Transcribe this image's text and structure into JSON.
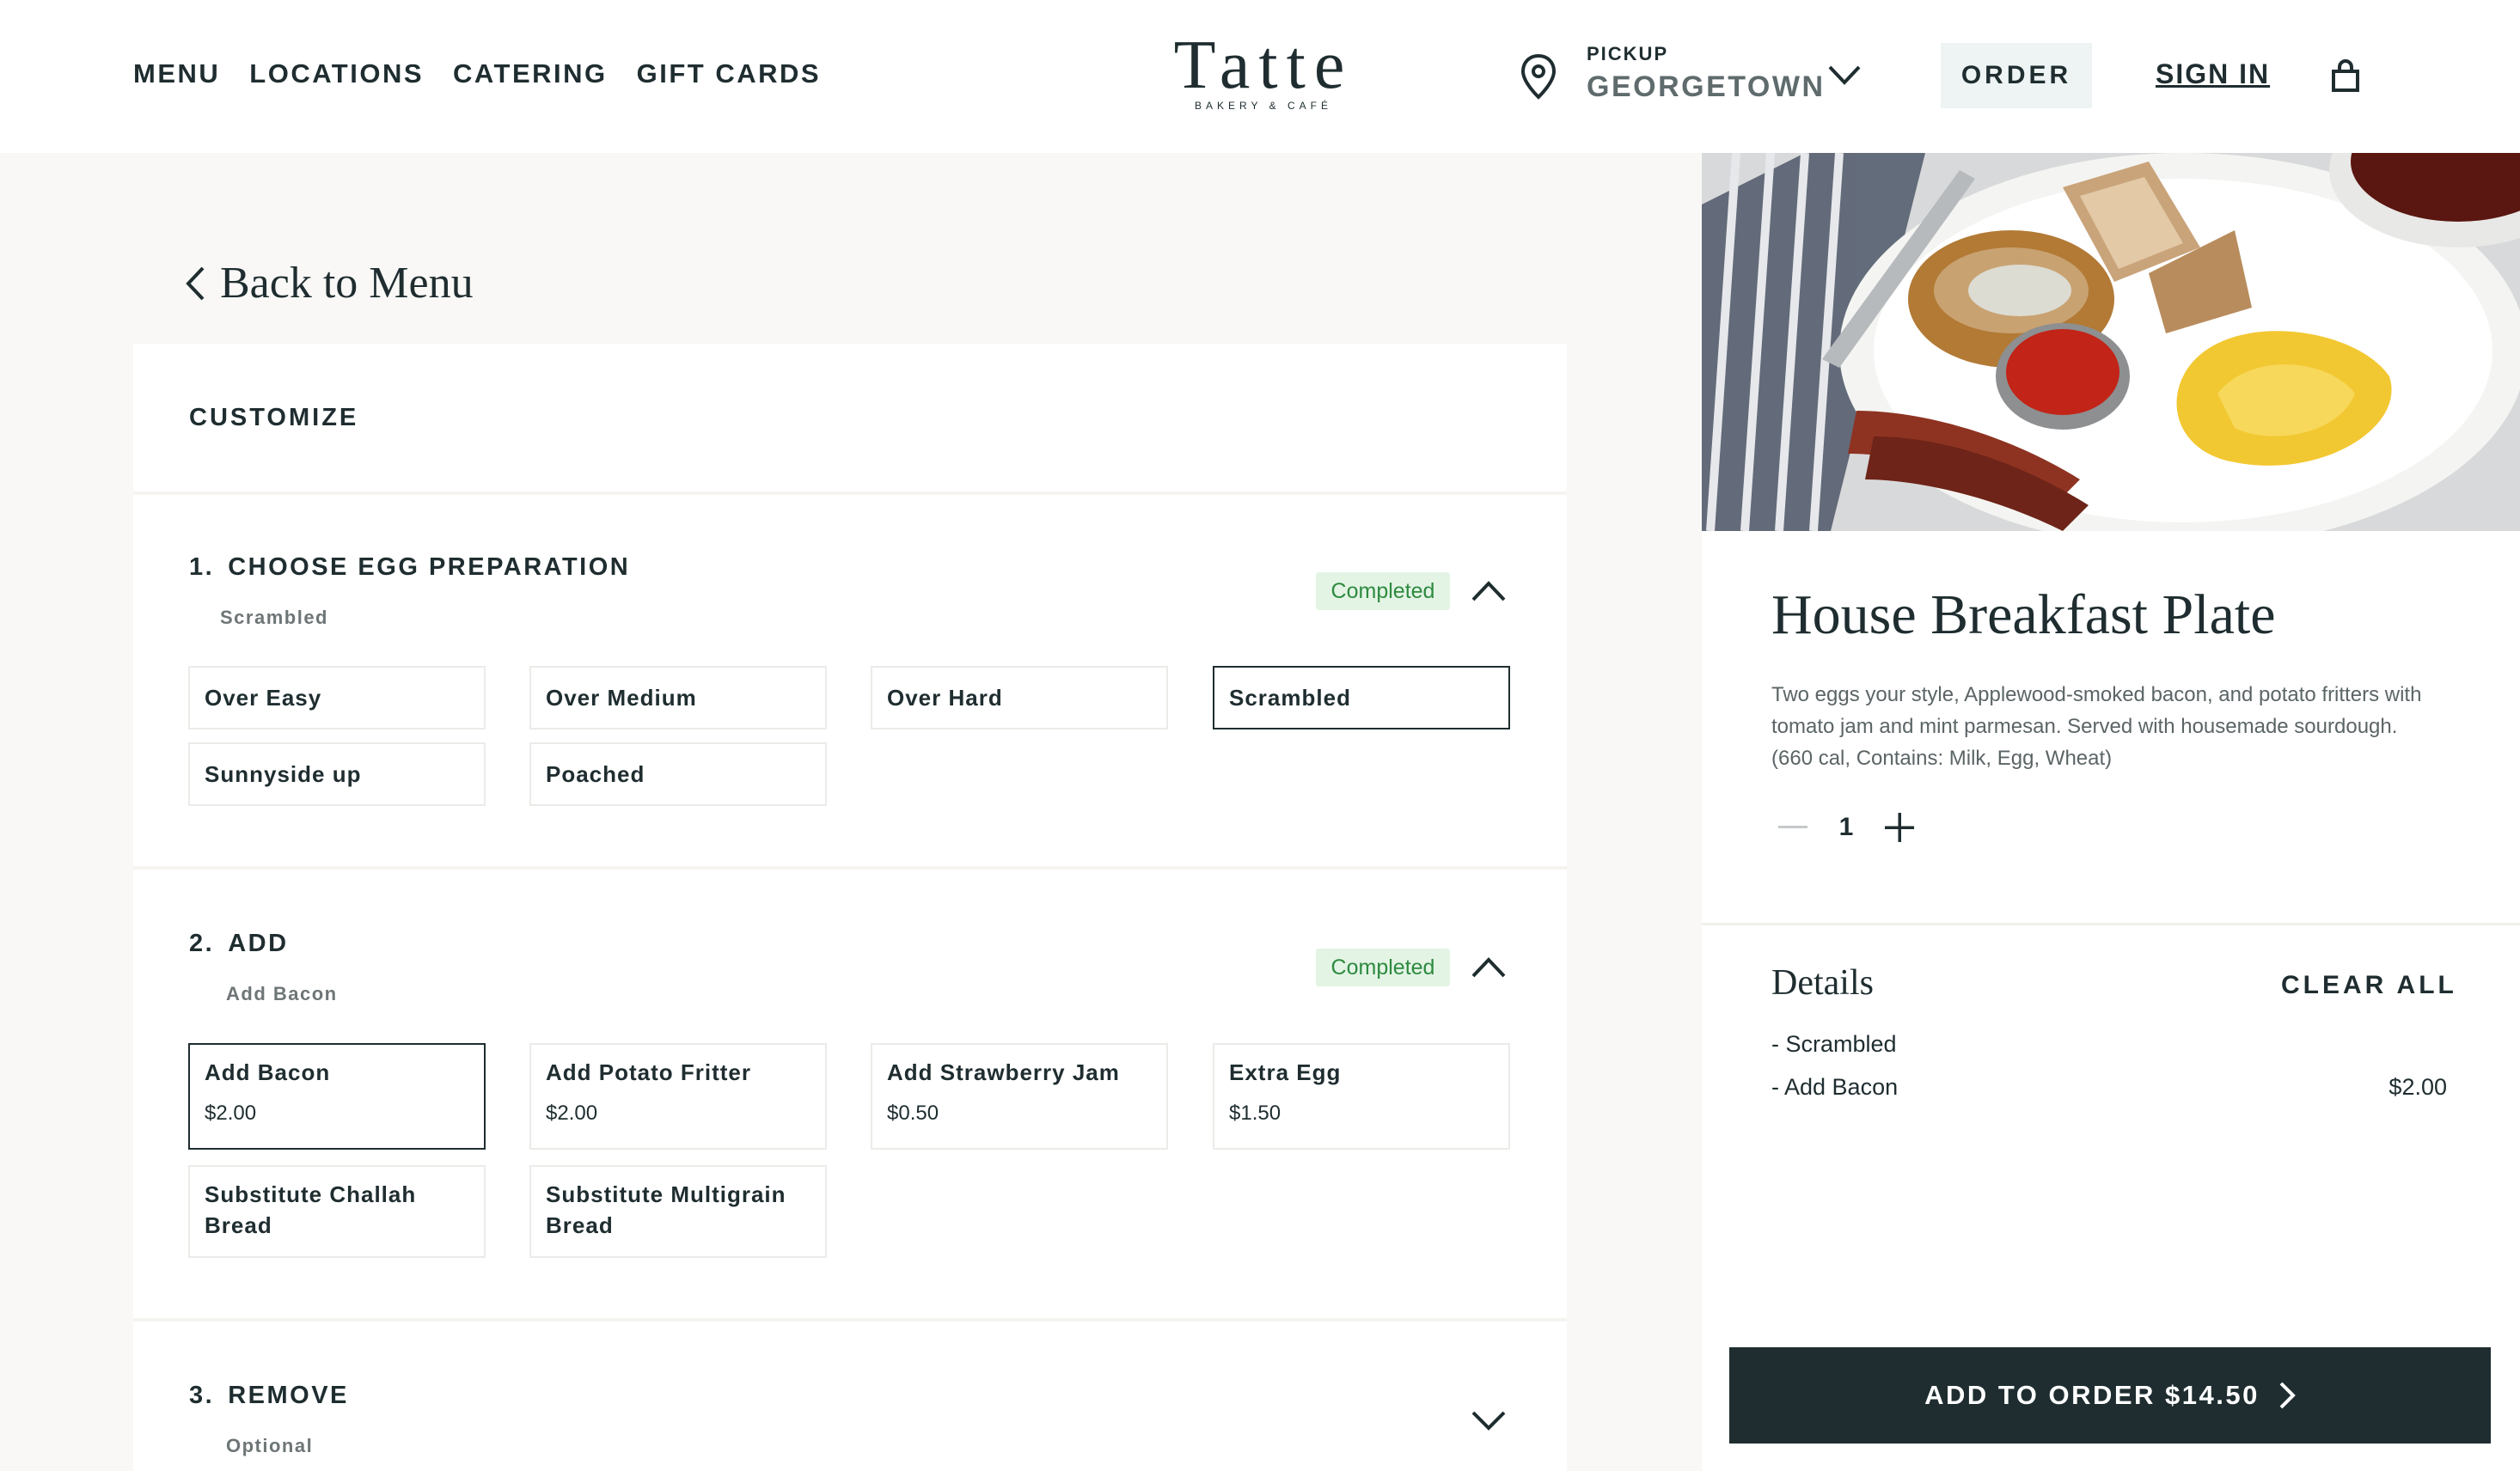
{
  "nav": {
    "items": [
      "MENU",
      "LOCATIONS",
      "CATERING",
      "GIFT CARDS"
    ]
  },
  "logo": {
    "name": "Tatte",
    "sub": "BAKERY & CAFÉ"
  },
  "pickup": {
    "label": "PICKUP",
    "location": "GEORGETOWN"
  },
  "header": {
    "order": "ORDER",
    "sign_in": "SIGN IN"
  },
  "back": {
    "label": "Back to Menu"
  },
  "customize": {
    "title": "CUSTOMIZE",
    "sections": [
      {
        "num": "1.",
        "title": "CHOOSE EGG PREPARATION",
        "summary": "Scrambled",
        "status": "Completed",
        "options": [
          {
            "name": "Over Easy"
          },
          {
            "name": "Over Medium"
          },
          {
            "name": "Over Hard"
          },
          {
            "name": "Scrambled"
          },
          {
            "name": "Sunnyside up"
          },
          {
            "name": "Poached"
          }
        ]
      },
      {
        "num": "2.",
        "title": "ADD",
        "summary": "Add Bacon",
        "status": "Completed",
        "options": [
          {
            "name": "Add Bacon",
            "price": "$2.00"
          },
          {
            "name": "Add Potato Fritter",
            "price": "$2.00"
          },
          {
            "name": "Add Strawberry Jam",
            "price": "$0.50"
          },
          {
            "name": "Extra Egg",
            "price": "$1.50"
          },
          {
            "name": "Substitute Challah Bread"
          },
          {
            "name": "Substitute Multigrain Bread"
          }
        ]
      },
      {
        "num": "3.",
        "title": "REMOVE",
        "summary": "Optional"
      }
    ]
  },
  "product": {
    "title": "House Breakfast Plate",
    "description": "Two eggs your style, Applewood-smoked bacon, and potato fritters with tomato jam and mint parmesan. Served with housemade sourdough. (660 cal, Contains: Milk, Egg, Wheat)",
    "quantity": "1"
  },
  "details": {
    "title": "Details",
    "clear_all": "CLEAR ALL",
    "lines": [
      {
        "label": "- Scrambled",
        "price": ""
      },
      {
        "label": "- Add Bacon",
        "price": "$2.00"
      }
    ]
  },
  "cta": {
    "label": "ADD TO ORDER $14.50"
  },
  "colors": {
    "primary": "#1f2d30",
    "completed_bg": "#e3f4e5",
    "completed_text": "#2d8a3f",
    "order_bg": "#eef3f4"
  }
}
